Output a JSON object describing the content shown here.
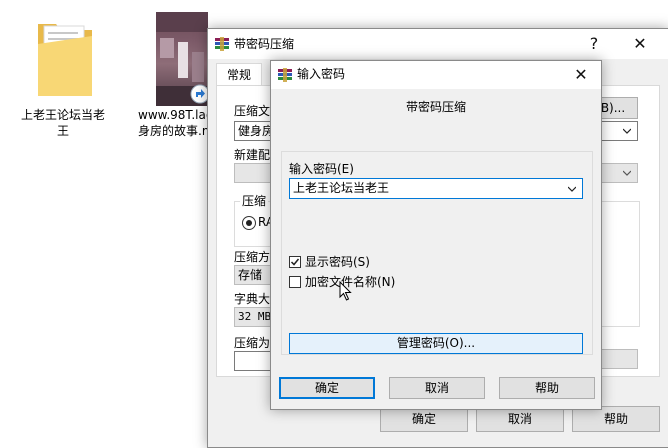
{
  "desktop": {
    "folder_label_line1": "上老王论坛当老",
    "folder_label_line2": "王",
    "video_label_line1": "www.98T.la@",
    "video_label_line2": "身房的故事.m"
  },
  "archive_dialog": {
    "title": "带密码压缩",
    "help_glyph": "?",
    "close_glyph": "✕",
    "tab_general": "常规",
    "label_archive_name": "压缩文",
    "archive_name_value": "健身房",
    "browse_button": "B)...",
    "label_profile": "新建配",
    "label_format": "压缩",
    "format_option": "RA",
    "label_method": "压缩方",
    "method_value": "存储",
    "label_dict": "字典大",
    "dict_value": "32 MB",
    "label_split": "压缩为",
    "ok_button": "确定",
    "cancel_button": "取消",
    "help_button": "帮助"
  },
  "password_dialog": {
    "title": "输入密码",
    "close_glyph": "✕",
    "heading": "带密码压缩",
    "label_password": "输入密码(E)",
    "password_value": "上老王论坛当老王",
    "show_password_label": "显示密码(S)",
    "show_password_checked": true,
    "encrypt_names_label": "加密文件名称(N)",
    "encrypt_names_checked": false,
    "manage_button": "管理密码(O)...",
    "ok_button": "确定",
    "cancel_button": "取消",
    "help_button": "帮助"
  }
}
